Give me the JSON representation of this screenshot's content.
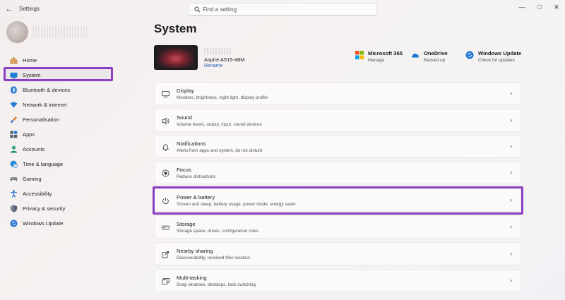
{
  "app": {
    "title": "Settings"
  },
  "search": {
    "placeholder": "Find a setting"
  },
  "sidebar": {
    "items": [
      {
        "label": "Home",
        "icon": "home-icon"
      },
      {
        "label": "System",
        "icon": "system-icon",
        "active": true
      },
      {
        "label": "Bluetooth & devices",
        "icon": "bluetooth-icon"
      },
      {
        "label": "Network & internet",
        "icon": "wifi-icon"
      },
      {
        "label": "Personalisation",
        "icon": "brush-icon"
      },
      {
        "label": "Apps",
        "icon": "apps-icon"
      },
      {
        "label": "Accounts",
        "icon": "account-icon"
      },
      {
        "label": "Time & language",
        "icon": "globe-clock-icon"
      },
      {
        "label": "Gaming",
        "icon": "gamepad-icon"
      },
      {
        "label": "Accessibility",
        "icon": "accessibility-icon"
      },
      {
        "label": "Privacy & security",
        "icon": "shield-icon"
      },
      {
        "label": "Windows Update",
        "icon": "update-icon"
      }
    ]
  },
  "main": {
    "title": "System",
    "device": {
      "name": "Aspire A515-48M",
      "rename_label": "Rename"
    },
    "quick_links": [
      {
        "title": "Microsoft 365",
        "subtitle": "Manage",
        "icon": "microsoft-logo-icon"
      },
      {
        "title": "OneDrive",
        "subtitle": "Backed up",
        "icon": "onedrive-cloud-icon"
      },
      {
        "title": "Windows Update",
        "subtitle": "Check for updates",
        "icon": "update-icon"
      }
    ],
    "cards": [
      {
        "title": "Display",
        "subtitle": "Monitors, brightness, night light, display profile",
        "icon": "monitor-icon"
      },
      {
        "title": "Sound",
        "subtitle": "Volume levels, output, input, sound devices",
        "icon": "speaker-icon"
      },
      {
        "title": "Notifications",
        "subtitle": "Alerts from apps and system, do not disturb",
        "icon": "bell-icon"
      },
      {
        "title": "Focus",
        "subtitle": "Reduce distractions",
        "icon": "focus-icon"
      },
      {
        "title": "Power & battery",
        "subtitle": "Screen and sleep, battery usage, power mode, energy saver",
        "icon": "power-icon"
      },
      {
        "title": "Storage",
        "subtitle": "Storage space, drives, configuration rules",
        "icon": "storage-icon"
      },
      {
        "title": "Nearby sharing",
        "subtitle": "Discoverability, received files location",
        "icon": "share-icon"
      },
      {
        "title": "Multi-tasking",
        "subtitle": "Snap windows, desktops, task switching",
        "icon": "multitask-icon"
      }
    ]
  },
  "colors": {
    "highlight": "#8b3fc2",
    "accent": "#0067c0",
    "link": "#2a61b8"
  }
}
